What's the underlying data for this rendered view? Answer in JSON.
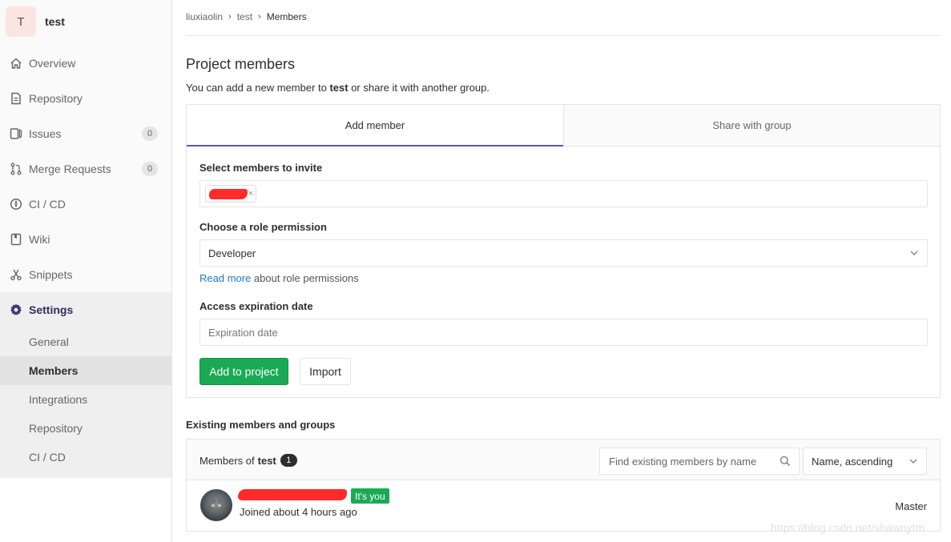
{
  "project": {
    "initial": "T",
    "name": "test"
  },
  "sidebar": {
    "items": [
      {
        "label": "Overview",
        "icon": "home-icon"
      },
      {
        "label": "Repository",
        "icon": "doc-icon"
      },
      {
        "label": "Issues",
        "icon": "issues-icon",
        "count": "0"
      },
      {
        "label": "Merge Requests",
        "icon": "merge-request-icon",
        "count": "0"
      },
      {
        "label": "CI / CD",
        "icon": "rocket-icon"
      },
      {
        "label": "Wiki",
        "icon": "book-icon"
      },
      {
        "label": "Snippets",
        "icon": "scissors-icon"
      },
      {
        "label": "Settings",
        "icon": "gear-icon"
      }
    ],
    "settings_sub": [
      "General",
      "Members",
      "Integrations",
      "Repository",
      "CI / CD"
    ]
  },
  "breadcrumb": {
    "a": "liuxiaolin",
    "b": "test",
    "c": "Members"
  },
  "page": {
    "title": "Project members",
    "desc_pre": "You can add a new member to ",
    "desc_proj": "test",
    "desc_post": " or share it with another group."
  },
  "tabs": {
    "add": "Add member",
    "share": "Share with group"
  },
  "form": {
    "select_label": "Select members to invite",
    "chip_remove": "×",
    "role_label": "Choose a role permission",
    "role_value": "Developer",
    "read_more": "Read more",
    "read_more_rest": " about role permissions",
    "expiry_label": "Access expiration date",
    "expiry_placeholder": "Expiration date",
    "add_button": "Add to project",
    "import_button": "Import"
  },
  "existing": {
    "title": "Existing members and groups",
    "members_of": "Members of",
    "project": "test",
    "count": "1",
    "search_placeholder": "Find existing members by name",
    "sort": "Name, ascending",
    "member": {
      "badge": "It's you",
      "joined": "Joined about 4 hours ago",
      "role": "Master"
    }
  },
  "watermark": "https://blog.csdn.net/shawnytm",
  "colors": {
    "accent": "#6b4fbb",
    "green": "#1aaa55",
    "link": "#1f78d1"
  }
}
